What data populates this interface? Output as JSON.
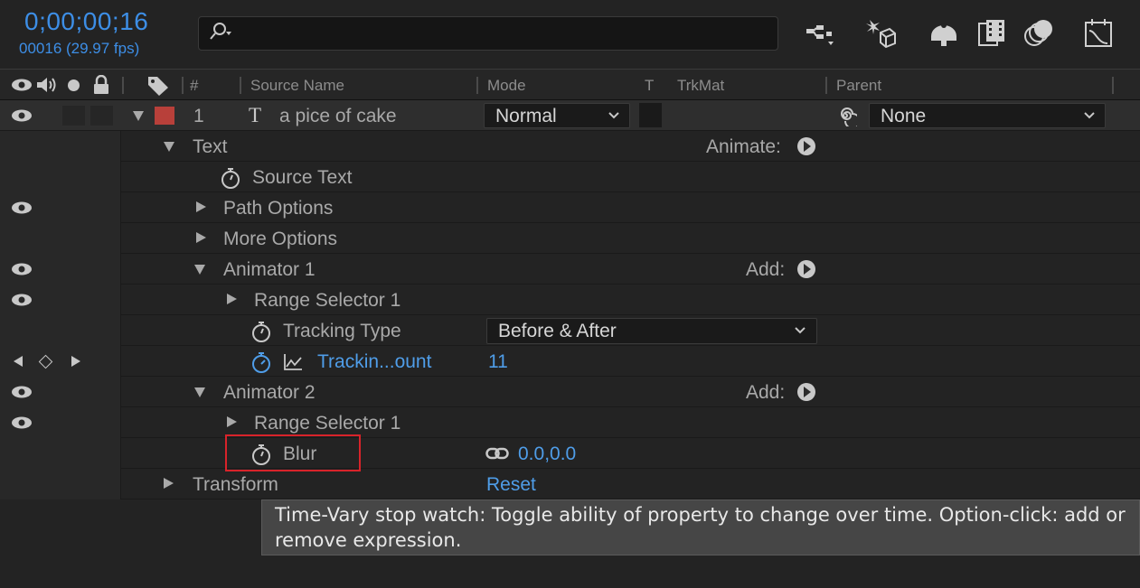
{
  "header": {
    "timecode": "0;00;00;16",
    "fps_readout": "00016 (29.97 fps)",
    "search": {
      "placeholder": "",
      "value": ""
    },
    "toolbar_icons": [
      "composition-mini-flowchart-icon",
      "draft-3d-icon",
      "shy-layers-icon",
      "frame-blending-icon",
      "motion-blur-icon",
      "graph-editor-icon"
    ]
  },
  "columns": {
    "number": "#",
    "source_name": "Source Name",
    "mode": "Mode",
    "t": "T",
    "trkmat": "TrkMat",
    "parent": "Parent"
  },
  "layer": {
    "index": "1",
    "type_glyph": "T",
    "name": "a pice of cake",
    "label_color": "#b8403a",
    "mode": "Normal",
    "parent": "None"
  },
  "props": {
    "text": "Text",
    "animate_label": "Animate:",
    "source_text": "Source Text",
    "path_options": "Path Options",
    "more_options": "More Options",
    "animator1": "Animator 1",
    "animator1_add": "Add:",
    "range_selector_1a": "Range Selector 1",
    "tracking_type": "Tracking Type",
    "tracking_type_value": "Before & After",
    "tracking_amount": "Trackin...ount",
    "tracking_amount_value": "11",
    "animator2": "Animator 2",
    "animator2_add": "Add:",
    "range_selector_1b": "Range Selector 1",
    "blur": "Blur",
    "blur_value": "0.0,0.0",
    "transform": "Transform",
    "transform_reset": "Reset"
  },
  "tooltip": {
    "text": "Time-Vary stop watch: Toggle ability of property to change over time. Option-click: add or remove expression."
  },
  "colors": {
    "accent_blue": "#4f9de8",
    "highlight_red": "#d8232a",
    "panel_bg": "#232323"
  }
}
